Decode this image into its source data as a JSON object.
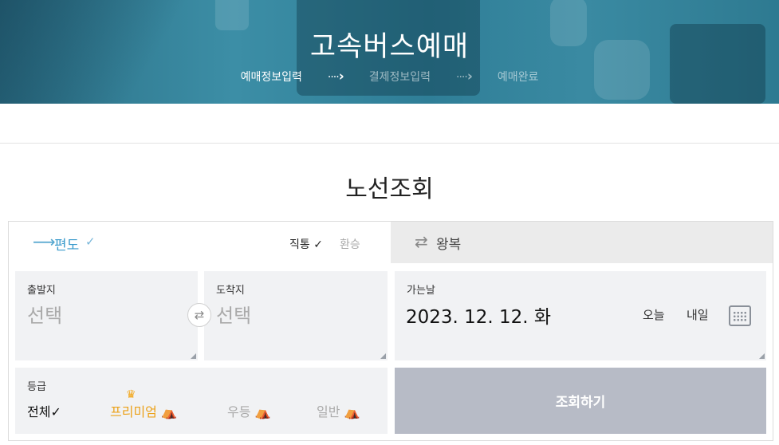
{
  "header": {
    "title": "고속버스예매",
    "steps": [
      {
        "label": "예매정보입력",
        "active": true
      },
      {
        "label": "결제정보입력",
        "active": false
      },
      {
        "label": "예매완료",
        "active": false
      }
    ],
    "step_arrow": "····"
  },
  "section": {
    "title": "노선조회"
  },
  "tabs": {
    "oneway": {
      "icon": "right-arrow-icon",
      "arrow_glyph": "⟶",
      "label": "편도",
      "check": "✓"
    },
    "direct": {
      "label": "직통",
      "check": "✓"
    },
    "transfer": {
      "label": "환승"
    },
    "roundtrip": {
      "icon": "swap-arrows-icon",
      "arrow_glyph": "⇄",
      "label": "왕복"
    }
  },
  "route": {
    "departure": {
      "label": "출발지",
      "value": "선택"
    },
    "arrival": {
      "label": "도착지",
      "value": "선택"
    },
    "swap_icon": "⇄"
  },
  "date": {
    "label": "가는날",
    "value": "2023. 12. 12. 화",
    "today": "오늘",
    "tomorrow": "내일",
    "calendar_icon": "calendar-icon"
  },
  "grade": {
    "label": "등급",
    "options": [
      {
        "label": "전체",
        "check": "✓",
        "selected": true
      },
      {
        "label": "프리미엄",
        "seat": "⛺",
        "crown": "♛",
        "selected": false
      },
      {
        "label": "우등",
        "seat": "⛺",
        "selected": false
      },
      {
        "label": "일반",
        "seat": "⛺",
        "selected": false
      }
    ]
  },
  "search_button": {
    "label": "조회하기"
  },
  "colors": {
    "accent_blue": "#3b9bcc",
    "premium_gold": "#eba21a",
    "search_button_bg": "#b7bbc6",
    "field_bg": "#f1f2f4"
  }
}
